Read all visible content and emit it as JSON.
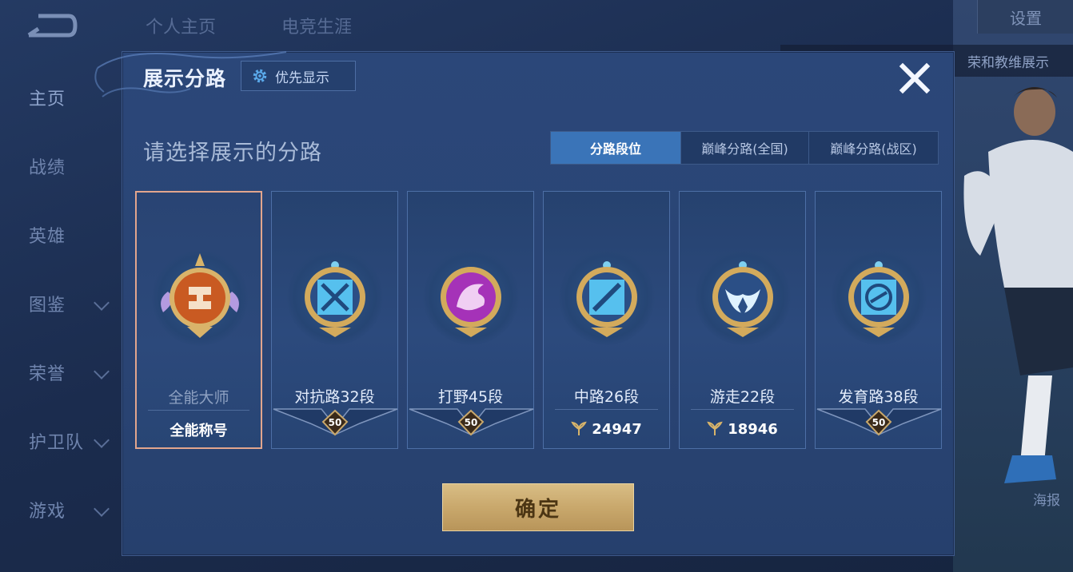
{
  "background": {
    "top_tabs": [
      "个人主页",
      "电竞生涯"
    ],
    "nav_items": [
      {
        "label": "主页",
        "chevron": false
      },
      {
        "label": "战绩",
        "chevron": false
      },
      {
        "label": "英雄",
        "chevron": false
      },
      {
        "label": "图鉴",
        "chevron": true
      },
      {
        "label": "荣誉",
        "chevron": true
      },
      {
        "label": "护卫队",
        "chevron": true
      },
      {
        "label": "游戏",
        "chevron": true
      }
    ],
    "settings_label": "设置",
    "banner_text": "荣和教维展示",
    "poster_label": "海报"
  },
  "dialog": {
    "title": "展示分路",
    "priority_button": "优先显示",
    "instruction": "请选择展示的分路",
    "tabs": [
      {
        "label": "分路段位",
        "active": true
      },
      {
        "label": "巅峰分路(全国)",
        "active": false
      },
      {
        "label": "巅峰分路(战区)",
        "active": false
      }
    ],
    "cards": [
      {
        "name": "全能大师",
        "footer_text": "全能称号",
        "footer_type": "text",
        "selected": true,
        "color": "#d4622a",
        "icon": "allround-emblem-icon"
      },
      {
        "name": "对抗路32段",
        "footer_text": "50",
        "footer_type": "star",
        "selected": false,
        "color": "#4fb4e8",
        "icon": "clash-lane-emblem-icon"
      },
      {
        "name": "打野45段",
        "footer_text": "50",
        "footer_type": "star",
        "selected": false,
        "color": "#b43fc8",
        "icon": "jungle-emblem-icon"
      },
      {
        "name": "中路26段",
        "footer_text": "24947",
        "footer_type": "points",
        "selected": false,
        "color": "#4fb4e8",
        "icon": "mid-lane-emblem-icon"
      },
      {
        "name": "游走22段",
        "footer_text": "18946",
        "footer_type": "points",
        "selected": false,
        "color": "#4fb4e8",
        "icon": "roam-emblem-icon"
      },
      {
        "name": "发育路38段",
        "footer_text": "50",
        "footer_type": "star",
        "selected": false,
        "color": "#4fb4e8",
        "icon": "farm-lane-emblem-icon"
      }
    ],
    "confirm_label": "确定"
  }
}
